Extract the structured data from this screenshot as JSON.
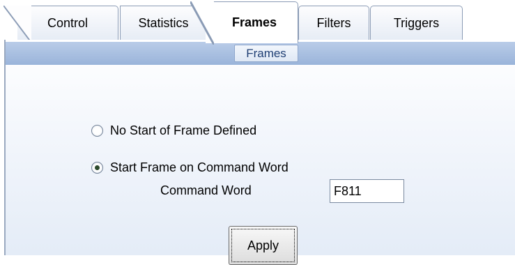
{
  "tabs": {
    "control": "Control",
    "statistics": "Statistics",
    "frames": "Frames",
    "filters": "Filters",
    "triggers": "Triggers",
    "active": "Frames"
  },
  "group": {
    "title": "Frames"
  },
  "options": {
    "no_start": {
      "label": "No Start of Frame Defined",
      "checked": false
    },
    "start_on_command": {
      "label": "Start Frame on Command Word",
      "checked": true
    }
  },
  "command_word": {
    "label": "Command Word",
    "value": "F811"
  },
  "apply_button": "Apply",
  "colors": {
    "header_bar": "#9ab4da",
    "group_title_text": "#1f3f74",
    "tab_border": "#8a9bb5"
  }
}
